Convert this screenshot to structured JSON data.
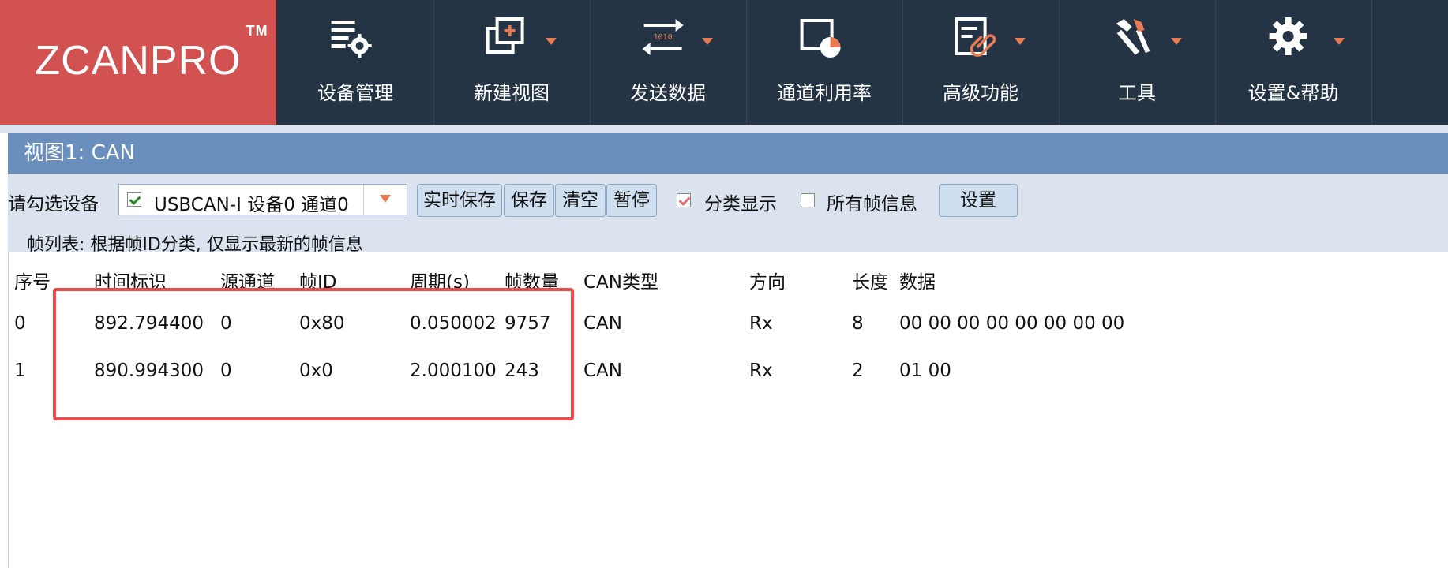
{
  "logo": {
    "text": "ZCANPRO",
    "tm": "TM"
  },
  "toolbar": [
    {
      "label": "设备管理",
      "icon": "device-manage-icon"
    },
    {
      "label": "新建视图",
      "icon": "new-view-icon"
    },
    {
      "label": "发送数据",
      "icon": "send-data-icon"
    },
    {
      "label": "通道利用率",
      "icon": "channel-usage-icon"
    },
    {
      "label": "高级功能",
      "icon": "advanced-icon"
    },
    {
      "label": "工具",
      "icon": "tools-icon"
    },
    {
      "label": "设置&帮助",
      "icon": "settings-gear-icon"
    }
  ],
  "view": {
    "title": "视图1: CAN"
  },
  "controls": {
    "select_label": "请勾选设备",
    "device": "USBCAN-I 设备0 通道0",
    "buttons": {
      "realtime_save": "实时保存",
      "save": "保存",
      "clear": "清空",
      "pause": "暂停"
    },
    "classify": "分类显示",
    "all_frames": "所有帧信息",
    "settings": "设置",
    "frame_list_note": "帧列表: 根据帧ID分类, 仅显示最新的帧信息"
  },
  "table": {
    "headers": [
      "序号",
      "时间标识",
      "源通道",
      "帧ID",
      "周期(s)",
      "帧数量",
      "CAN类型",
      "方向",
      "长度",
      "数据"
    ],
    "rows": [
      [
        "0",
        "892.794400",
        "0",
        "0x80",
        "0.050002",
        "9757",
        "CAN",
        "Rx",
        "8",
        "00 00 00 00 00 00 00 00"
      ],
      [
        "1",
        "890.994300",
        "0",
        "0x0",
        "2.000100",
        "243",
        "CAN",
        "Rx",
        "2",
        "01 00"
      ]
    ]
  },
  "colors": {
    "toolbar_bg": "#243445",
    "logo_bg": "#d25151",
    "view_title_bg": "#6a8fbd",
    "accent_orange": "#e87b54",
    "highlight": "#ee4b4b"
  }
}
